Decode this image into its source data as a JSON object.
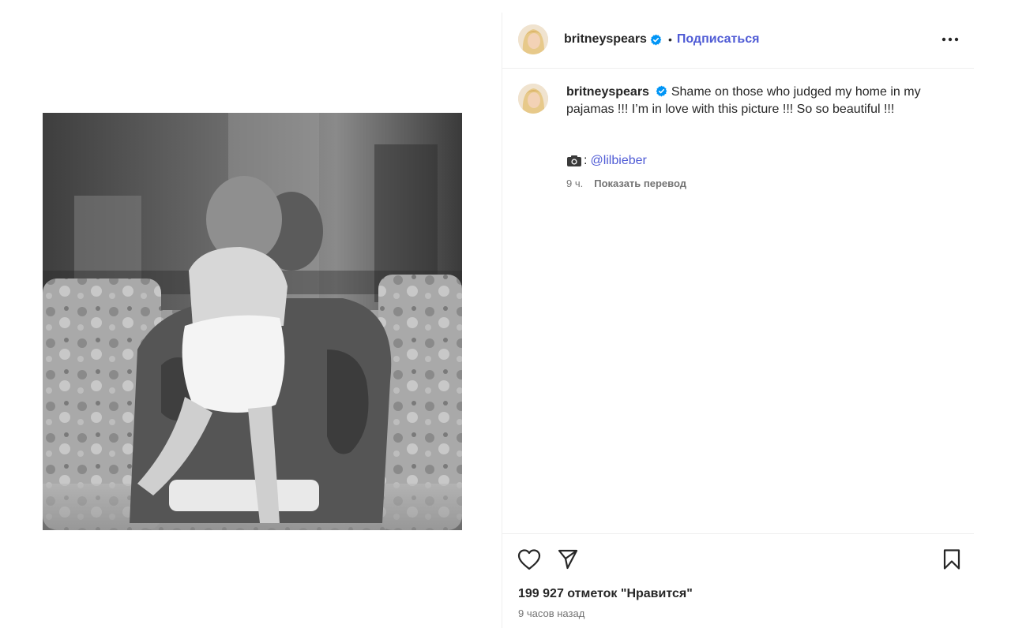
{
  "post": {
    "username": "britneyspears",
    "separator": "•",
    "follow_label": "Подписаться",
    "more_label": "More options",
    "photo_alt": "Black and white photo of a baby standing on a tattooed man's lap on a floral sofa"
  },
  "caption": {
    "username": "britneyspears",
    "text": "Shame on those who judged my home in my pajamas !!! I’m in love with this picture !!! So so beautiful !!!",
    "credit_prefix": ":",
    "credit_mention": "@lilbieber",
    "time": "9 ч.",
    "translate_label": "Показать перевод"
  },
  "actions": {
    "likes": "199 927 отметок \"Нравится\"",
    "time_ago": "9 часов назад"
  },
  "colors": {
    "link": "#4f5bd5",
    "verified": "#0095f6",
    "text": "#262626",
    "muted": "#737373"
  },
  "icons": [
    "verified-badge-icon",
    "more-options-icon",
    "camera-icon",
    "heart-icon",
    "send-icon",
    "bookmark-icon"
  ]
}
